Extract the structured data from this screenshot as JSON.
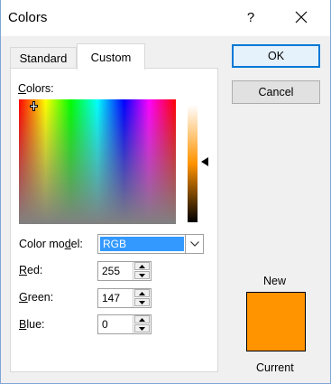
{
  "window": {
    "title": "Colors",
    "help_label": "?"
  },
  "tabs": [
    {
      "label": "Standard",
      "selected": false
    },
    {
      "label": "Custom",
      "selected": true
    }
  ],
  "custom": {
    "colors_label_u": "C",
    "colors_label_rest": "olors:",
    "color_model_label_pre": "Color mo",
    "color_model_label_u": "d",
    "color_model_label_post": "el:",
    "color_model_value": "RGB",
    "fields": {
      "red": {
        "label_u": "R",
        "label_rest": "ed:",
        "value": "255"
      },
      "green": {
        "label_u": "G",
        "label_rest": "reen:",
        "value": "147"
      },
      "blue": {
        "label_u": "B",
        "label_rest": "lue:",
        "value": "0"
      }
    }
  },
  "buttons": {
    "ok": "OK",
    "cancel": "Cancel"
  },
  "preview": {
    "new_label": "New",
    "current_label": "Current",
    "color": "#ff9300"
  },
  "colors": {
    "accent": "#0078d7",
    "selection": "#3399ff"
  },
  "icons": [
    "close-icon",
    "chevron-down-icon",
    "spin-up-icon",
    "spin-down-icon",
    "crosshair-icon",
    "triangle-left-icon"
  ]
}
